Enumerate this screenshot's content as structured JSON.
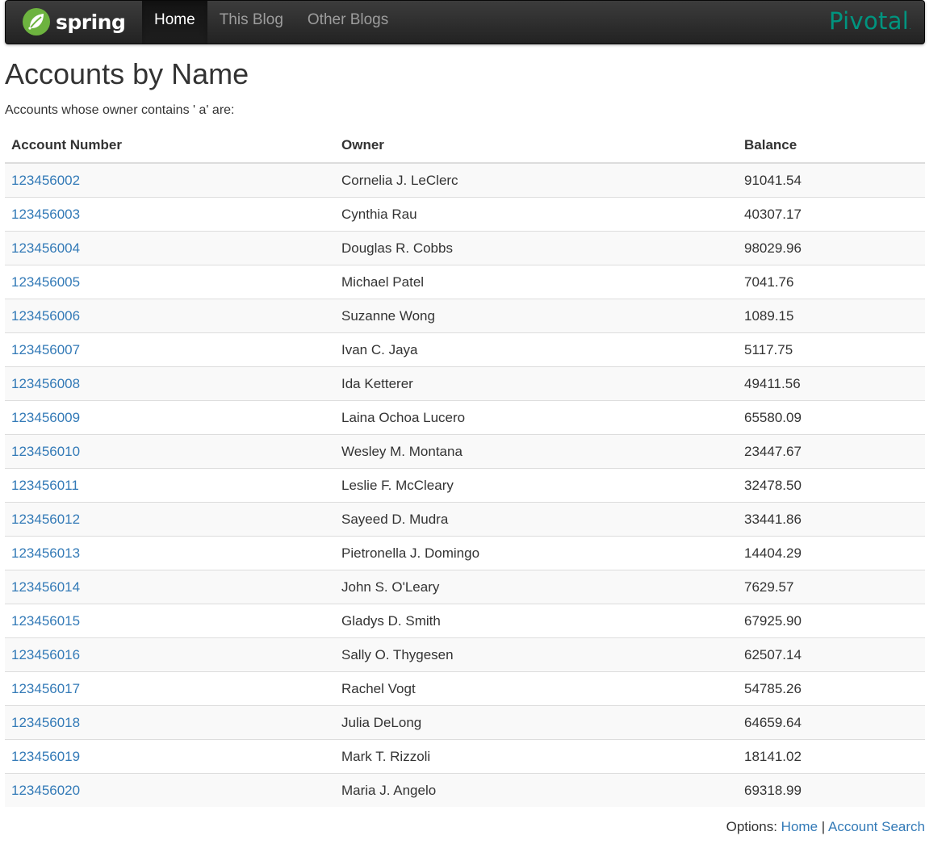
{
  "navbar": {
    "brand": "spring",
    "items": [
      {
        "label": "Home",
        "active": true
      },
      {
        "label": "This Blog",
        "active": false
      },
      {
        "label": "Other Blogs",
        "active": false
      }
    ],
    "pivotal_logo": "Pivotal",
    "brand_color": "#6db33f",
    "pivotal_color": "#00947f"
  },
  "page": {
    "title": "Accounts by Name",
    "subtitle": "Accounts whose owner contains ' a' are:"
  },
  "table": {
    "headers": [
      "Account Number",
      "Owner",
      "Balance"
    ],
    "rows": [
      [
        "123456002",
        "Cornelia J. LeClerc",
        "91041.54"
      ],
      [
        "123456003",
        "Cynthia Rau",
        "40307.17"
      ],
      [
        "123456004",
        "Douglas R. Cobbs",
        "98029.96"
      ],
      [
        "123456005",
        "Michael Patel",
        "7041.76"
      ],
      [
        "123456006",
        "Suzanne Wong",
        "1089.15"
      ],
      [
        "123456007",
        "Ivan C. Jaya",
        "5117.75"
      ],
      [
        "123456008",
        "Ida Ketterer",
        "49411.56"
      ],
      [
        "123456009",
        "Laina Ochoa Lucero",
        "65580.09"
      ],
      [
        "123456010",
        "Wesley M. Montana",
        "23447.67"
      ],
      [
        "123456011",
        "Leslie F. McCleary",
        "32478.50"
      ],
      [
        "123456012",
        "Sayeed D. Mudra",
        "33441.86"
      ],
      [
        "123456013",
        "Pietronella J. Domingo",
        "14404.29"
      ],
      [
        "123456014",
        "John S. O'Leary",
        "7629.57"
      ],
      [
        "123456015",
        "Gladys D. Smith",
        "67925.90"
      ],
      [
        "123456016",
        "Sally O. Thygesen",
        "62507.14"
      ],
      [
        "123456017",
        "Rachel Vogt",
        "54785.26"
      ],
      [
        "123456018",
        "Julia DeLong",
        "64659.64"
      ],
      [
        "123456019",
        "Mark T. Rizzoli",
        "18141.02"
      ],
      [
        "123456020",
        "Maria J. Angelo",
        "69318.99"
      ]
    ]
  },
  "options": {
    "label": "Options:",
    "home_link": "Home",
    "separator": "|",
    "search_link": "Account Search"
  }
}
